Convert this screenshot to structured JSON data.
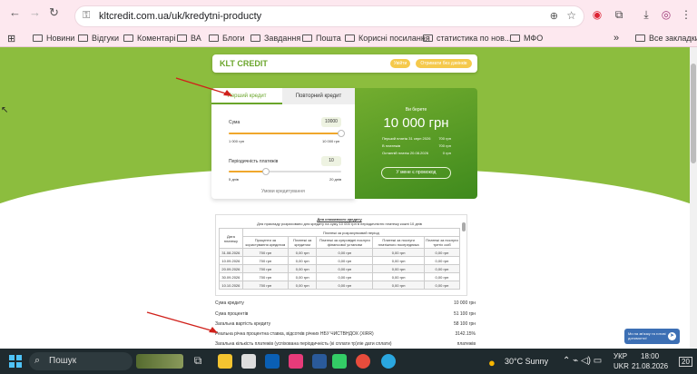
{
  "browser": {
    "url": "kltcredit.com.ua/uk/kredytni-producty",
    "bookmarks": [
      "Новини",
      "Відгуки",
      "Коментарі",
      "ВА",
      "Блоги",
      "Завдання",
      "Пошта",
      "Корисні посилання",
      "статистика по нов...",
      "МФО"
    ],
    "all_bookmarks": "Все закладки",
    "more": "»"
  },
  "site": {
    "logo": "KLT CREDIT",
    "header_btn_1": "Увійти",
    "header_btn_2": "Отримати без дзвінків"
  },
  "calculator": {
    "tab_first": "Перший кредит",
    "tab_repeat": "Повторний кредит",
    "amount_label": "Сума",
    "amount_value": "10000",
    "amount_min": "1 000 грн",
    "amount_max": "10 000 грн",
    "amount_fraction": 1.0,
    "term_label": "Періодичність платежів",
    "term_value": "10",
    "term_min": "5 днів",
    "term_max": "20 днів",
    "term_fraction": 0.33,
    "conditions_link": "Умови кредитування"
  },
  "result": {
    "title": "Ви берете",
    "amount": "10 000 грн",
    "rows": [
      {
        "label": "Перший платіж 31 серп 2026",
        "value": "700 грн"
      },
      {
        "label": "В платежів",
        "value": "700 грн"
      },
      {
        "label": "Останній платіж 20.08.2026",
        "value": "0 грн"
      }
    ],
    "button": "У мене є промокод"
  },
  "table": {
    "title": "Для споживчого кредиту",
    "subtitle": "Для прикладу розраховано для кредиту на суму 10 000 грн в періодичністю платежу кожні 10 днів",
    "group_header": "Платежі за розрахунковий період",
    "headers": [
      "Дата платежу",
      "Проценти за користування кредитом",
      "Платежі за кредитом",
      "Платежі за супровідні послуги фінансової установи",
      "Платежі за послуги платіжного посередника",
      "Платежі за послуги третіх осіб"
    ],
    "rows": [
      [
        "31.08.2026",
        "700 грн",
        "0,00 грн",
        "0,00 грн",
        "0,00 грн",
        "0,00 грн"
      ],
      [
        "10.09.2026",
        "700 грн",
        "0,00 грн",
        "0,00 грн",
        "0,00 грн",
        "0,00 грн"
      ],
      [
        "20.09.2026",
        "700 грн",
        "0,00 грн",
        "0,00 грн",
        "0,00 грн",
        "0,00 грн"
      ],
      [
        "30.09.2026",
        "700 грн",
        "0,00 грн",
        "0,00 грн",
        "0,00 грн",
        "0,00 грн"
      ],
      [
        "10.10.2026",
        "700 грн",
        "0,00 грн",
        "0,00 грн",
        "0,00 грн",
        "0,00 грн"
      ]
    ]
  },
  "summary": [
    {
      "label": "Сума кредиту",
      "value": "10 000 грн"
    },
    {
      "label": "Сума процентів",
      "value": "51 100 грн"
    },
    {
      "label": "Загальна вартість кредиту",
      "value": "58 100 грн"
    },
    {
      "label": "Реальна річна процентна ставка, відсотків річних НБУ ЧИСТВНДОХ (XIRR)",
      "value": "3142.15%"
    },
    {
      "label": "Загальна кількість платежів (успіхована періодичність (кі сплати тр)ліе дати сплати)",
      "value": "платежів"
    }
  ],
  "chat_widget": "Ми на зв'язку та готові допомогти!",
  "taskbar": {
    "search": "Пошук",
    "weather": "30°C  Sunny",
    "lang_top": "УКР",
    "lang_bottom": "UKR",
    "time": "18:00",
    "date": "21.08.2026",
    "notif": "20"
  },
  "colors": {
    "brand_green": "#8cbd3e",
    "accent_orange": "#f0a72c",
    "chrome_pink": "#fde8ef"
  }
}
